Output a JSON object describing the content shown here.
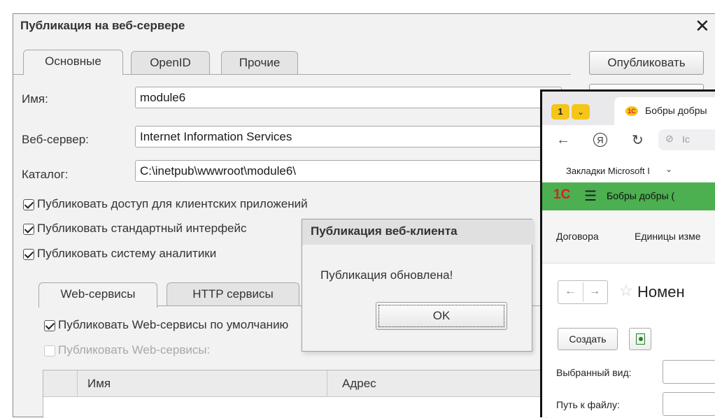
{
  "main_window": {
    "title": "Публикация на веб-сервере",
    "close_symbol": "✕",
    "tabs": [
      {
        "label": "Основные",
        "active": true
      },
      {
        "label": "OpenID",
        "active": false
      },
      {
        "label": "Прочие",
        "active": false
      }
    ],
    "fields": {
      "name_label": "Имя:",
      "name_value": "module6",
      "server_label": "Веб-сервер:",
      "server_value": "Internet Information Services",
      "catalog_label": "Каталог:",
      "catalog_value": "C:\\inetpub\\wwwroot\\module6\\"
    },
    "checkboxes": [
      {
        "label": "Публиковать доступ для клиентских приложений",
        "checked": true
      },
      {
        "label": "Публиковать стандартный интерфейс",
        "checked": true
      },
      {
        "label": "Публиковать систему аналитики",
        "checked": true
      }
    ],
    "publish_button": "Опубликовать",
    "subtabs": [
      {
        "label": "Web-сервисы",
        "active": true
      },
      {
        "label": "HTTP сервисы",
        "active": false
      }
    ],
    "ws_checkboxes": [
      {
        "label": "Публиковать Web-сервисы по умолчанию",
        "checked": true,
        "disabled": false
      },
      {
        "label": "Публиковать Web-сервисы:",
        "checked": false,
        "disabled": true
      }
    ],
    "table_headers": [
      "Имя",
      "Адрес"
    ]
  },
  "dialog": {
    "title": "Публикация веб-клиента",
    "message": "Публикация обновлена!",
    "ok_label": "OK"
  },
  "browser": {
    "tab_count": "1",
    "tab_title": "Бобры добры",
    "address_partial": "Ic",
    "bookmarks_label": "Закладки Microsoft I",
    "app_title": "Бобры добры (",
    "nav_items": [
      "Договора",
      "Единицы изме"
    ],
    "page_title": "Номен",
    "create_button": "Создать",
    "form_labels": [
      "Выбранный вид:",
      "Путь к файлу:"
    ],
    "colors": {
      "green_bar": "#4caf50",
      "yellow_tab": "#f5c518",
      "logo_red": "#d81f26"
    }
  }
}
